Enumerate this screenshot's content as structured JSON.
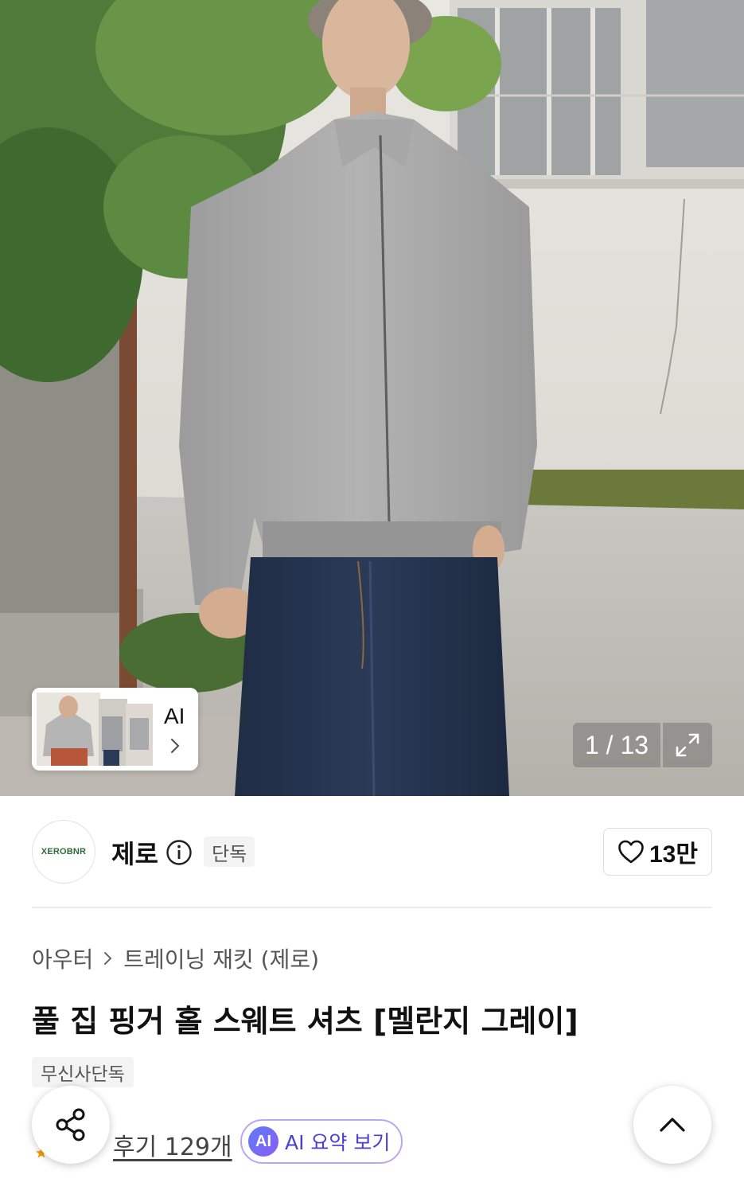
{
  "gallery": {
    "ai_label": "AI",
    "current": "1",
    "total": "13",
    "counter_text": "1 / 13",
    "thumbnail_count": 3
  },
  "brand": {
    "logo_text": "XEROBNR",
    "name": "제로",
    "exclusive_tag": "단독",
    "likes": "13만"
  },
  "product": {
    "breadcrumb": [
      "아우터",
      "트레이닝 재킷 (제로)"
    ],
    "title": "풀 집 핑거 홀 스웨트 셔츠 [멜란지 그레이]",
    "tag": "무신사단독"
  },
  "reviews": {
    "link_text": "후기 129개",
    "ai_badge": "AI",
    "ai_summary_label": "AI 요약 보기"
  },
  "icons": {
    "info": "info-icon",
    "like": "heart-icon",
    "share": "share-icon",
    "scroll_top": "chevron-up-icon",
    "expand": "expand-icon",
    "chevron": "chevron-right-icon"
  },
  "colors": {
    "ai_accent": "#4b3fd1",
    "ai_border": "#b9a7f2",
    "logo_green": "#2f6b3a"
  }
}
